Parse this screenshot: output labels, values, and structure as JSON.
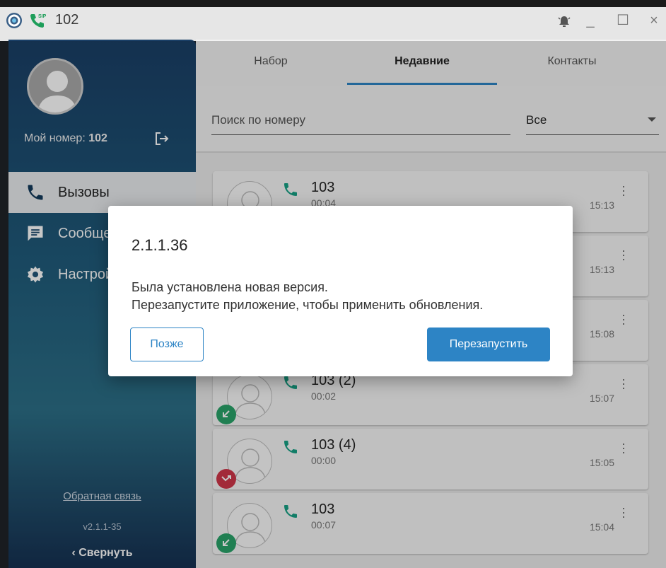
{
  "window": {
    "title": "102",
    "logo_icon": "app-logo-icon",
    "sip_icon": "sip-phone-icon",
    "bell_icon": "alarm-bell-icon",
    "minimize": "_",
    "maximize": "☐",
    "close": "×"
  },
  "sidebar": {
    "my_number_label": "Мой номер:",
    "my_number_value": "102",
    "nav": [
      {
        "label": "Вызовы",
        "icon": "phone-icon",
        "active": true
      },
      {
        "label": "Сообщения",
        "icon": "message-icon",
        "active": false
      },
      {
        "label": "Настройки",
        "icon": "gear-icon",
        "active": false
      }
    ],
    "feedback": "Обратная связь",
    "version": "v2.1.1-35",
    "collapse": "‹  Свернуть"
  },
  "tabs": [
    {
      "label": "Набор"
    },
    {
      "label": "Недавние",
      "active": true
    },
    {
      "label": "Контакты"
    }
  ],
  "search": {
    "placeholder": "Поиск по номеру",
    "filter_value": "Все"
  },
  "calls": [
    {
      "number": "103",
      "duration": "00:04",
      "time": "15:13",
      "status": "none"
    },
    {
      "number": "",
      "duration": "",
      "time": "15:13",
      "status": "none"
    },
    {
      "number": "",
      "duration": "",
      "time": "15:08",
      "status": "none"
    },
    {
      "number": "103 (2)",
      "duration": "00:02",
      "time": "15:07",
      "status": "incoming"
    },
    {
      "number": "103 (4)",
      "duration": "00:00",
      "time": "15:05",
      "status": "missed"
    },
    {
      "number": "103",
      "duration": "00:07",
      "time": "15:04",
      "status": "incoming"
    }
  ],
  "dialog": {
    "title": "2.1.1.36",
    "line1": "Была установлена новая версия.",
    "line2": "Перезапустите приложение, чтобы применить обновления.",
    "later_button": "Позже",
    "restart_button": "Перезапустить"
  },
  "colors": {
    "accent": "#2d84c5",
    "incoming": "#2aa36a",
    "missed": "#d0374a",
    "phone_green": "#16a085"
  }
}
